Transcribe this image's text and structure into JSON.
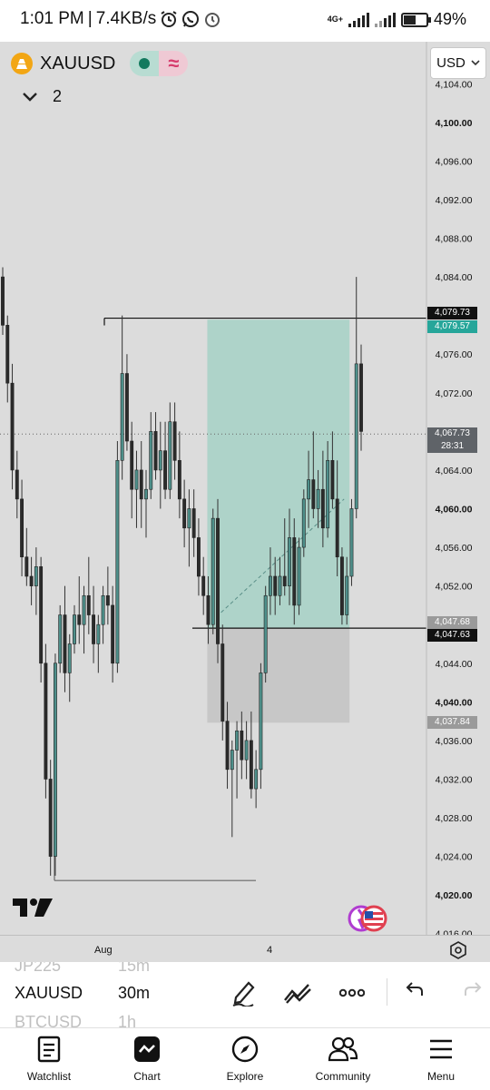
{
  "status_bar": {
    "time": "1:01 PM",
    "speed": "7.4KB/s",
    "network": "4G+",
    "battery": "49%"
  },
  "header": {
    "symbol": "XAUUSD",
    "currency": "USD",
    "interval_count": "2"
  },
  "price_axis": {
    "ticks": [
      "4,104.00",
      "4,100.00",
      "4,096.00",
      "4,092.00",
      "4,088.00",
      "4,084.00",
      "4,076.00",
      "4,072.00",
      "4,064.00",
      "4,060.00",
      "4,056.00",
      "4,052.00",
      "4,044.00",
      "4,040.00",
      "4,036.00",
      "4,032.00",
      "4,028.00",
      "4,024.00",
      "4,020.00",
      "4,016.00"
    ],
    "bold_ticks": [
      "4,100.00",
      "4,060.00",
      "4,040.00",
      "4,020.00"
    ],
    "labels": {
      "upper_line": "4,079.73",
      "take_profit": "4,079.57",
      "current_price": "4,067.73",
      "countdown": "28:31",
      "entry": "4,047.68",
      "lower_line": "4,047.63",
      "stop_loss": "4,037.84"
    }
  },
  "time_axis": {
    "labels": [
      "Aug",
      "4"
    ]
  },
  "chart_data": {
    "type": "candlestick",
    "symbol": "XAUUSD",
    "ylim": [
      4014,
      4106
    ],
    "current_price": 4067.73,
    "candles": [
      [
        4084,
        4085,
        4078,
        4079
      ],
      [
        4079,
        4080,
        4071,
        4073
      ],
      [
        4073,
        4075,
        4062,
        4064
      ],
      [
        4064,
        4066,
        4059,
        4061
      ],
      [
        4061,
        4063,
        4053,
        4055
      ],
      [
        4055,
        4058,
        4052,
        4053
      ],
      [
        4053,
        4055,
        4050,
        4052
      ],
      [
        4052,
        4056,
        4049,
        4054
      ],
      [
        4054,
        4055,
        4042,
        4044
      ],
      [
        4044,
        4046,
        4030,
        4032
      ],
      [
        4032,
        4034,
        4022,
        4024
      ],
      [
        4024,
        4045,
        4022,
        4044
      ],
      [
        4044,
        4050,
        4043,
        4049
      ],
      [
        4049,
        4052,
        4041,
        4043
      ],
      [
        4043,
        4047,
        4040,
        4046
      ],
      [
        4046,
        4050,
        4045,
        4049
      ],
      [
        4049,
        4053,
        4046,
        4048
      ],
      [
        4048,
        4052,
        4045,
        4051
      ],
      [
        4051,
        4055,
        4047,
        4049
      ],
      [
        4049,
        4052,
        4044,
        4046
      ],
      [
        4046,
        4049,
        4043,
        4048
      ],
      [
        4048,
        4052,
        4046,
        4051
      ],
      [
        4051,
        4054,
        4048,
        4050
      ],
      [
        4050,
        4052,
        4042,
        4044
      ],
      [
        4044,
        4067,
        4043,
        4065
      ],
      [
        4065,
        4080,
        4063,
        4074
      ],
      [
        4074,
        4076,
        4066,
        4067
      ],
      [
        4067,
        4069,
        4059,
        4062
      ],
      [
        4062,
        4066,
        4058,
        4064
      ],
      [
        4064,
        4067,
        4058,
        4061
      ],
      [
        4061,
        4064,
        4057,
        4062
      ],
      [
        4062,
        4070,
        4061,
        4068
      ],
      [
        4068,
        4070,
        4063,
        4064
      ],
      [
        4064,
        4069,
        4060,
        4066
      ],
      [
        4066,
        4069,
        4061,
        4062
      ],
      [
        4062,
        4071,
        4061,
        4069
      ],
      [
        4069,
        4071,
        4063,
        4065
      ],
      [
        4065,
        4068,
        4059,
        4061
      ],
      [
        4061,
        4063,
        4056,
        4058
      ],
      [
        4058,
        4062,
        4054,
        4060
      ],
      [
        4060,
        4062,
        4055,
        4057
      ],
      [
        4057,
        4059,
        4051,
        4053
      ],
      [
        4053,
        4055,
        4049,
        4051
      ],
      [
        4051,
        4053,
        4046,
        4048
      ],
      [
        4048,
        4060,
        4047,
        4059
      ],
      [
        4059,
        4061,
        4044,
        4046
      ],
      [
        4046,
        4048,
        4036,
        4038
      ],
      [
        4038,
        4040,
        4031,
        4033
      ],
      [
        4033,
        4036,
        4026,
        4035
      ],
      [
        4035,
        4038,
        4030,
        4037
      ],
      [
        4037,
        4039,
        4032,
        4034
      ],
      [
        4034,
        4038,
        4032,
        4036
      ],
      [
        4036,
        4039,
        4030,
        4031
      ],
      [
        4031,
        4035,
        4029,
        4033
      ],
      [
        4033,
        4044,
        4031,
        4043
      ],
      [
        4043,
        4052,
        4042,
        4051
      ],
      [
        4051,
        4056,
        4049,
        4053
      ],
      [
        4053,
        4055,
        4049,
        4051
      ],
      [
        4051,
        4055,
        4050,
        4053
      ],
      [
        4053,
        4059,
        4051,
        4052
      ],
      [
        4052,
        4060,
        4050,
        4057
      ],
      [
        4057,
        4059,
        4048,
        4050
      ],
      [
        4050,
        4057,
        4049,
        4056
      ],
      [
        4056,
        4062,
        4055,
        4061
      ],
      [
        4061,
        4066,
        4058,
        4063
      ],
      [
        4063,
        4068,
        4059,
        4060
      ],
      [
        4060,
        4064,
        4058,
        4062
      ],
      [
        4062,
        4066,
        4056,
        4058
      ],
      [
        4058,
        4067,
        4057,
        4065
      ],
      [
        4065,
        4068,
        4060,
        4061
      ],
      [
        4061,
        4065,
        4053,
        4055
      ],
      [
        4055,
        4056,
        4048,
        4049
      ],
      [
        4049,
        4055,
        4048,
        4053
      ],
      [
        4053,
        4061,
        4052,
        4060
      ],
      [
        4060,
        4084,
        4059,
        4075
      ],
      [
        4075,
        4077,
        4066,
        4068
      ]
    ],
    "lines": [
      {
        "price": 4079.73
      },
      {
        "price": 4047.63
      },
      {
        "price": 4021.5
      }
    ],
    "position": {
      "take_profit": 4079.57,
      "entry": 4047.68,
      "stop_loss": 4037.84
    }
  },
  "toolbar": {
    "symbols": [
      {
        "symbol": "JP225",
        "interval": "15m"
      },
      {
        "symbol": "XAUUSD",
        "interval": "30m"
      },
      {
        "symbol": "BTCUSD",
        "interval": "1h"
      }
    ]
  },
  "bottom_nav": {
    "items": [
      {
        "label": "Watchlist"
      },
      {
        "label": "Chart"
      },
      {
        "label": "Explore"
      },
      {
        "label": "Community"
      },
      {
        "label": "Menu"
      }
    ]
  },
  "colors": {
    "bull": "#4e8f8a",
    "bear": "#2b2b2b",
    "take_profit_zone": "#9fd0c3",
    "stop_loss_zone": "#c4c4c4",
    "accent_green": "#26a69a"
  }
}
